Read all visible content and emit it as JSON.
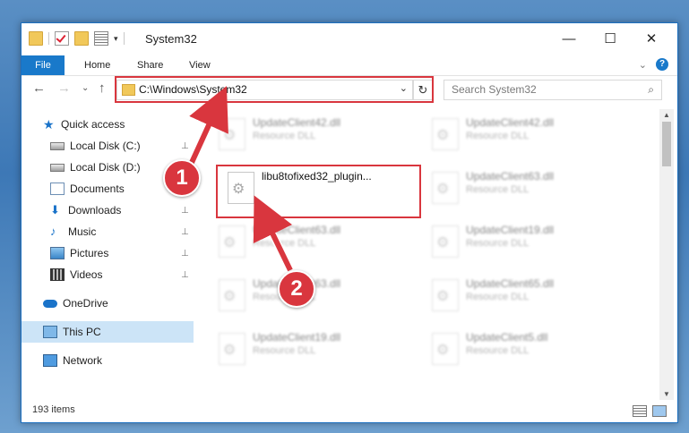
{
  "window": {
    "title": "System32",
    "minimize": "—",
    "maximize": "☐",
    "close": "✕"
  },
  "ribbon": {
    "tabs": [
      "File",
      "Home",
      "Share",
      "View"
    ],
    "expand": "⌄",
    "help": "?"
  },
  "nav": {
    "back": "←",
    "forward": "→",
    "recent": "⌄",
    "up": "↑",
    "address": "C:\\Windows\\System32",
    "address_dropdown": "⌄",
    "refresh": "↻",
    "search_placeholder": "Search System32",
    "search_icon": "⌕"
  },
  "sidebar": {
    "items": [
      {
        "label": "Quick access",
        "icon": "star-icon",
        "pinned": false
      },
      {
        "label": "Local Disk (C:)",
        "icon": "drive-icon",
        "pinned": true
      },
      {
        "label": "Local Disk (D:)",
        "icon": "drive-icon",
        "pinned": false
      },
      {
        "label": "Documents",
        "icon": "documents-icon",
        "pinned": true
      },
      {
        "label": "Downloads",
        "icon": "downloads-icon",
        "pinned": true
      },
      {
        "label": "Music",
        "icon": "music-icon",
        "pinned": true
      },
      {
        "label": "Pictures",
        "icon": "pictures-icon",
        "pinned": true
      },
      {
        "label": "Videos",
        "icon": "videos-icon",
        "pinned": true
      },
      {
        "label": "OneDrive",
        "icon": "onedrive-icon",
        "pinned": false
      },
      {
        "label": "This PC",
        "icon": "this-pc-icon",
        "pinned": false,
        "selected": true
      },
      {
        "label": "Network",
        "icon": "network-icon",
        "pinned": false
      }
    ],
    "pin_glyph": "📌"
  },
  "files": {
    "left_column": [
      {
        "name": "UpdateClient42.dll",
        "type": "Resource DLL"
      },
      {
        "name": "UpdateClient63.dll",
        "type": "Resource DLL"
      },
      {
        "name": "UpdateClient63.dll",
        "type": "Resource DLL"
      },
      {
        "name": "UpdateClient19.dll",
        "type": "Resource DLL"
      }
    ],
    "right_column": [
      {
        "name": "UpdateClient42.dll",
        "type": "Resource DLL"
      },
      {
        "name": "UpdateClient63.dll",
        "type": "Resource DLL"
      },
      {
        "name": "UpdateClient19.dll",
        "type": "Resource DLL"
      },
      {
        "name": "UpdateClient65.dll",
        "type": "Resource DLL"
      },
      {
        "name": "UpdateClient5.dll",
        "type": "Resource DLL"
      }
    ],
    "highlighted": {
      "name": "libu8tofixed32_plugin..."
    }
  },
  "status": {
    "item_count": "193 items"
  },
  "annotations": {
    "marker_1": "1",
    "marker_2": "2",
    "accent_color": "#d9363e"
  }
}
